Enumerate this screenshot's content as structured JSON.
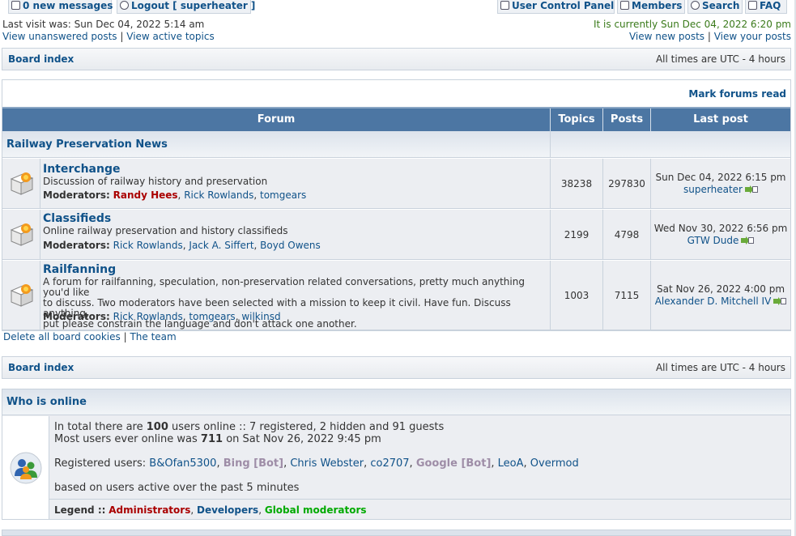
{
  "topbar": {
    "messages": "0 new messages",
    "logout": "Logout [ superheater ]",
    "ucp": "User Control Panel",
    "members": "Members",
    "search": "Search",
    "faq": "FAQ"
  },
  "visit": {
    "last_visit": "Last visit was: Sun Dec 04, 2022 5:14 am",
    "current_time": "It is currently Sun Dec 04, 2022 6:20 pm",
    "unanswered": "View unanswered posts",
    "active": "View active topics",
    "new_posts": "View new posts",
    "your_posts": "View your posts",
    "separator": "|"
  },
  "navbar": {
    "board_index": "Board index",
    "timezone": "All times are UTC - 4 hours"
  },
  "forum_table": {
    "mark_read": "Mark forums read",
    "headers": {
      "forum": "Forum",
      "topics": "Topics",
      "posts": "Posts",
      "last_post": "Last post"
    },
    "category": "Railway Preservation News",
    "moderators_label": "Moderators:",
    "forums": [
      {
        "name": "Interchange",
        "description": "Discussion of railway history and preservation",
        "moderators": [
          "Randy Hees",
          "Rick Rowlands",
          "tomgears"
        ],
        "topics": "38238",
        "posts": "297830",
        "last_post_date": "Sun Dec 04, 2022 6:15 pm",
        "last_post_author": "superheater"
      },
      {
        "name": "Classifieds",
        "description": "Online railway preservation and history classifieds",
        "moderators": [
          "Rick Rowlands",
          "Jack A. Siffert",
          "Boyd Owens"
        ],
        "topics": "2199",
        "posts": "4798",
        "last_post_date": "Wed Nov 30, 2022 6:56 pm",
        "last_post_author": "GTW Dude"
      },
      {
        "name": "Railfanning",
        "description": "A forum for railfanning, speculation, non-preservation related conversations, pretty much anything you'd like\nto discuss. Two moderators have been selected with a mission to keep it civil. Have fun. Discuss anything,\nput please constrain the language and don't attack one another.",
        "moderators": [
          "Rick Rowlands",
          "tomgears",
          "wilkinsd"
        ],
        "topics": "1003",
        "posts": "7115",
        "last_post_date": "Sat Nov 26, 2022 4:00 pm",
        "last_post_author": "Alexander D. Mitchell IV"
      }
    ]
  },
  "footer_links": {
    "delete_cookies": "Delete all board cookies",
    "team": "The team"
  },
  "who_online": {
    "title": "Who is online",
    "total_prefix": "In total there are",
    "total_count": "100",
    "total_suffix": "users online :: 7 registered, 2 hidden and 91 guests",
    "most_prefix": "Most users ever online was",
    "most_count": "711",
    "most_suffix": "on Sat Nov 26, 2022 9:45 pm",
    "registered_label": "Registered users:",
    "registered_users": [
      "B&Ofan5300",
      "Bing [Bot]",
      "Chris Webster",
      "co2707",
      "Google [Bot]",
      "LeoA",
      "Overmod"
    ],
    "active_note": "based on users active over the past 5 minutes",
    "legend_label": "Legend ::",
    "legend": [
      "Administrators",
      "Developers",
      "Global moderators"
    ]
  },
  "colors": {
    "header_blue": "#4c76a3",
    "link": "#105289",
    "admin": "#aa0000",
    "bot": "#9e8da7",
    "global_mod": "#00aa00"
  },
  "icons": [
    "envelope-icon",
    "logout-icon",
    "user-control-panel-icon",
    "members-icon",
    "search-icon",
    "faq-icon",
    "forum-folder-icon",
    "go-to-post-icon",
    "users-online-icon"
  ]
}
